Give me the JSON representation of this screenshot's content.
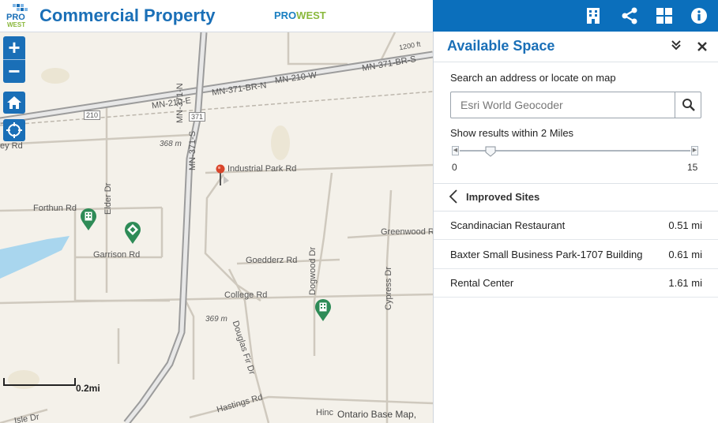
{
  "header": {
    "logo_text_top": "PRO",
    "logo_text_bottom": "WEST",
    "title": "Commercial Property",
    "brand_pro": "PRO",
    "brand_west": "WEST"
  },
  "toolbar": {
    "icons": [
      "building-icon",
      "share-icon",
      "grid-icon",
      "info-icon"
    ]
  },
  "map": {
    "zoom_in": "+",
    "zoom_out": "−",
    "labels": {
      "ey_rd": "ey Rd",
      "mn210e": "MN-210-E",
      "mn371n": "MN-371-N",
      "mn371brn": "MN-371-BR-N",
      "mn210w": "MN-210-W",
      "mn371brs": "MN-371-BR-S",
      "ft1200": "1200 ft",
      "shield210": "210",
      "shield371": "371",
      "mn371s": "MN-371-S",
      "m368": "368 m",
      "industrial": "Industrial Park Rd",
      "forthun": "Forthun Rd",
      "elder": "Elder Dr",
      "garrison": "Garrison Rd",
      "goedderz": "Goedderz Rd",
      "greenwood": "Greenwood Rd",
      "dogwood": "Dogwood Dr",
      "cypress": "Cypress Dr",
      "college": "College Rd",
      "m369": "369 m",
      "douglas": "Douglas Fir Dr",
      "hastings": "Hastings Rd",
      "hinc": "Hinc",
      "isle": "Isle Dr"
    },
    "scale_label": "0.2mi",
    "attribution": "Ontario Base Map,"
  },
  "panel": {
    "title": "Available Space",
    "search_label": "Search an address or locate on map",
    "search_placeholder": "Esri World Geocoder",
    "radius_label": "Show results within 2 Miles",
    "slider": {
      "min": "0",
      "max": "15",
      "value": 2
    },
    "section_title": "Improved Sites",
    "results": [
      {
        "name": "Scandinacian Restaurant",
        "distance": "0.51 mi"
      },
      {
        "name": "Baxter Small Business Park-1707 Building",
        "distance": "0.61 mi"
      },
      {
        "name": "Rental Center",
        "distance": "1.61 mi"
      }
    ]
  },
  "colors": {
    "accent": "#0b6fbc",
    "title_blue": "#1a6fb7",
    "brand_green": "#8ab83c",
    "pin_green": "#2e8b57",
    "pin_red": "#d9452b",
    "water": "#a9d6ee"
  }
}
